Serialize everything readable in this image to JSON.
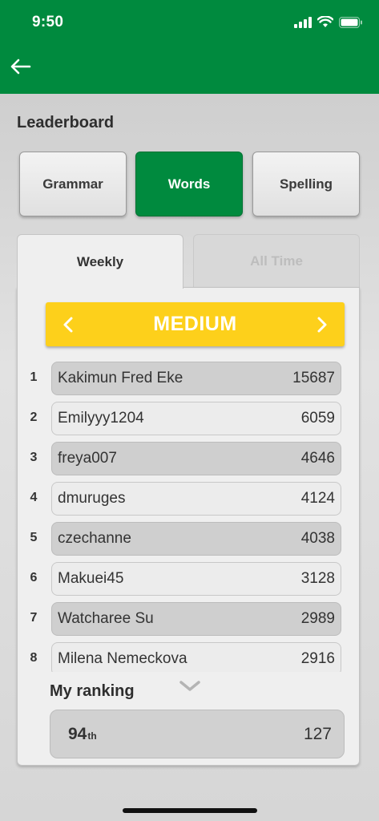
{
  "status_bar": {
    "time": "9:50"
  },
  "page": {
    "title": "Leaderboard"
  },
  "categories": [
    {
      "label": "Grammar",
      "active": false
    },
    {
      "label": "Words",
      "active": true
    },
    {
      "label": "Spelling",
      "active": false
    }
  ],
  "tabs": [
    {
      "label": "Weekly",
      "active": true
    },
    {
      "label": "All Time",
      "active": false
    }
  ],
  "level": {
    "label": "MEDIUM"
  },
  "leaderboard": [
    {
      "rank": "1",
      "name": "Kakimun Fred Eke",
      "score": "15687"
    },
    {
      "rank": "2",
      "name": "Emilyyy1204",
      "score": "6059"
    },
    {
      "rank": "3",
      "name": "freya007",
      "score": "4646"
    },
    {
      "rank": "4",
      "name": "dmuruges",
      "score": "4124"
    },
    {
      "rank": "5",
      "name": "czechanne",
      "score": "4038"
    },
    {
      "rank": "6",
      "name": "Makuei45",
      "score": "3128"
    },
    {
      "rank": "7",
      "name": "Watcharee Su",
      "score": "2989"
    },
    {
      "rank": "8",
      "name": "Milena Nemeckova",
      "score": "2916"
    }
  ],
  "my_ranking": {
    "label": "My ranking",
    "position": "94",
    "suffix": "th",
    "score": "127"
  },
  "colors": {
    "header": "#008a3e",
    "active_button": "#008a3e",
    "level_bar": "#fdd01b"
  },
  "icons": {
    "back": "arrow-left-icon",
    "prev": "chevron-left-icon",
    "next": "chevron-right-icon",
    "more": "chevron-down-icon"
  }
}
